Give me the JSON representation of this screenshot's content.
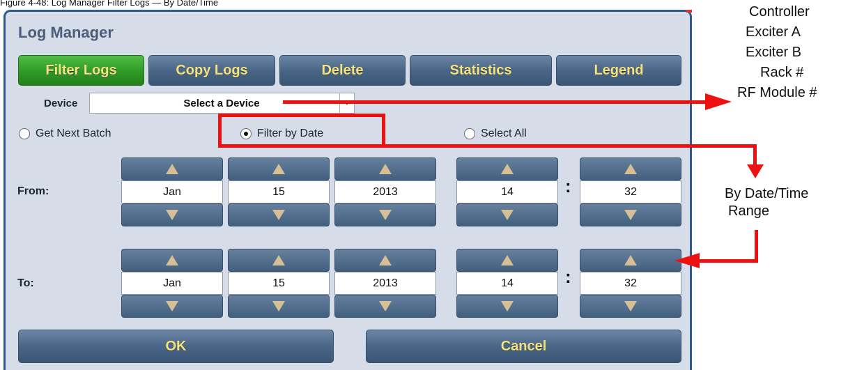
{
  "caption": "Figure 4-48: Log Manager Filter Logs — By Date/Time",
  "window": {
    "title": "Log Manager"
  },
  "tabs": [
    {
      "label": "Filter Logs",
      "active": true
    },
    {
      "label": "Copy Logs"
    },
    {
      "label": "Delete"
    },
    {
      "label": "Statistics"
    },
    {
      "label": "Legend"
    }
  ],
  "device": {
    "label": "Device",
    "value": "Select a Device"
  },
  "radios": [
    {
      "label": "Get Next Batch",
      "selected": false
    },
    {
      "label": "Filter by Date",
      "selected": true
    },
    {
      "label": "Select All",
      "selected": false
    }
  ],
  "from": {
    "label": "From:",
    "month": "Jan",
    "day": "15",
    "year": "2013",
    "hour": "14",
    "minute": "32"
  },
  "to": {
    "label": "To:",
    "month": "Jan",
    "day": "15",
    "year": "2013",
    "hour": "14",
    "minute": "32"
  },
  "time_separator": ":",
  "buttons": {
    "ok": "OK",
    "cancel": "Cancel"
  },
  "annotations": {
    "devices": [
      "Controller",
      "Exciter A",
      "Exciter B",
      "Rack #",
      "RF Module #"
    ],
    "date_range": [
      "By Date/Time",
      "Range"
    ]
  },
  "colors": {
    "active_tab": "#2e9a26",
    "button": "#4a6686",
    "button_text": "#f6e27a",
    "callout": "#ee1111"
  }
}
